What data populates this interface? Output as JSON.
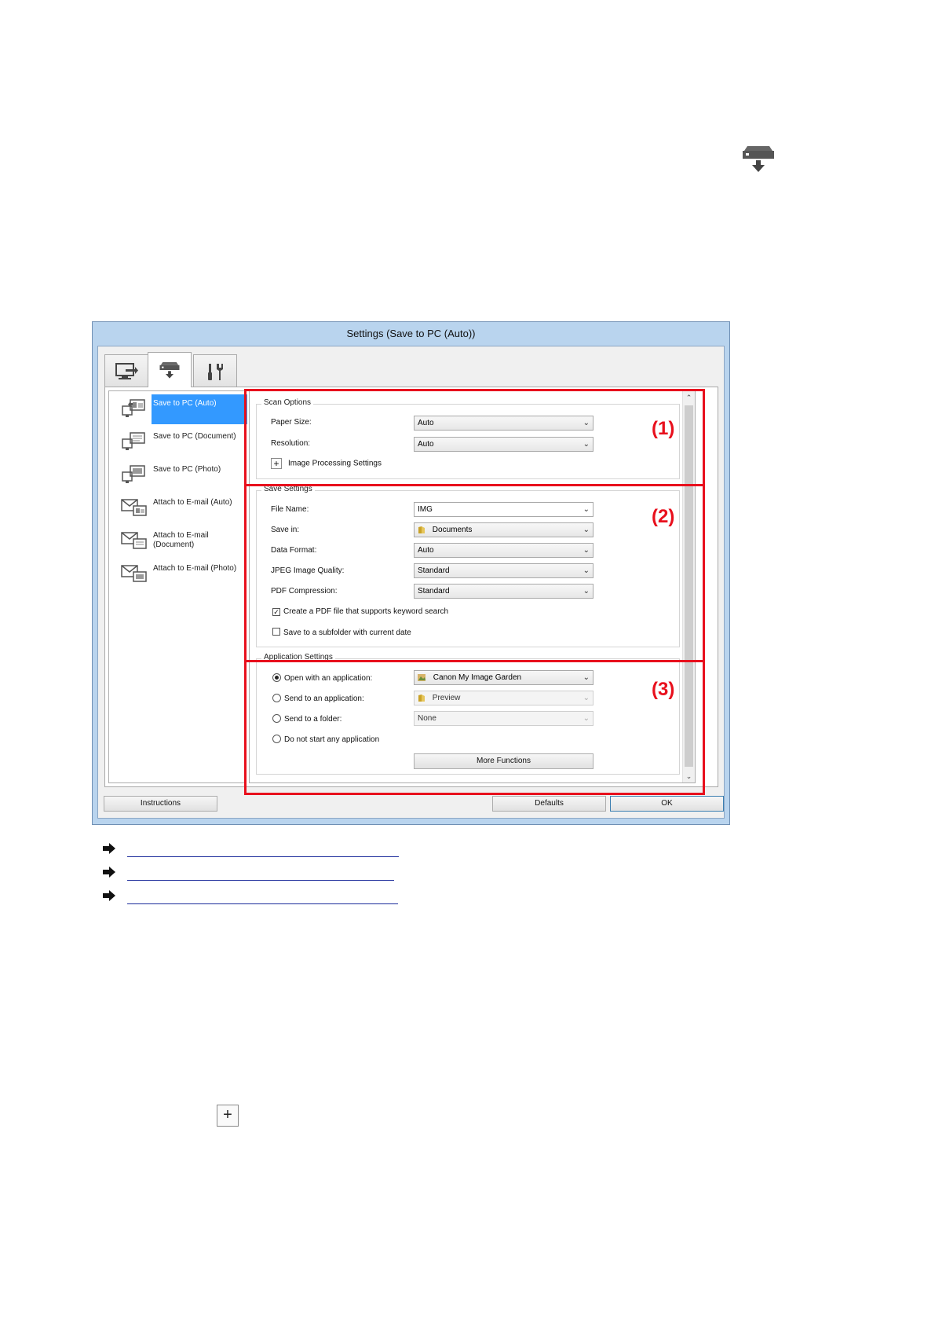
{
  "window": {
    "title": "Settings (Save to PC (Auto))"
  },
  "tabs": [
    {
      "icon": "scan-from-computer-icon",
      "active": false
    },
    {
      "icon": "scan-from-operation-panel-icon",
      "active": true
    },
    {
      "icon": "general-settings-icon",
      "active": false
    }
  ],
  "left_list": {
    "items": [
      {
        "label": "Save to PC (Auto)",
        "icon": "save-to-pc-auto-icon",
        "selected": true
      },
      {
        "label": "Save to PC (Document)",
        "icon": "save-to-pc-document-icon",
        "selected": false
      },
      {
        "label": "Save to PC (Photo)",
        "icon": "save-to-pc-photo-icon",
        "selected": false
      },
      {
        "label": "Attach to E-mail (Auto)",
        "icon": "attach-email-auto-icon",
        "selected": false
      },
      {
        "label": "Attach to E-mail (Document)",
        "icon": "attach-email-document-icon",
        "selected": false
      },
      {
        "label": "Attach to E-mail (Photo)",
        "icon": "attach-email-photo-icon",
        "selected": false
      }
    ]
  },
  "scan_options": {
    "title": "Scan Options",
    "paper_size_label": "Paper Size:",
    "paper_size_value": "Auto",
    "resolution_label": "Resolution:",
    "resolution_value": "Auto",
    "image_processing_label": "Image Processing Settings"
  },
  "save_settings": {
    "title": "Save Settings",
    "file_name_label": "File Name:",
    "file_name_value": "IMG",
    "save_in_label": "Save in:",
    "save_in_value": "Documents",
    "data_format_label": "Data Format:",
    "data_format_value": "Auto",
    "jpeg_quality_label": "JPEG Image Quality:",
    "jpeg_quality_value": "Standard",
    "pdf_compression_label": "PDF Compression:",
    "pdf_compression_value": "Standard",
    "keyword_search_label": "Create a PDF file that supports keyword search",
    "keyword_search_checked": true,
    "subfolder_label": "Save to a subfolder with current date",
    "subfolder_checked": false
  },
  "application_settings": {
    "title": "Application Settings",
    "open_app_label": "Open with an application:",
    "open_app_value": "Canon My Image Garden",
    "send_app_label": "Send to an application:",
    "send_app_value": "Preview",
    "send_folder_label": "Send to a folder:",
    "send_folder_value": "None",
    "do_not_start_label": "Do not start any application",
    "selected_option": "open_app",
    "more_functions_label": "More Functions"
  },
  "buttons": {
    "instructions": "Instructions",
    "defaults": "Defaults",
    "ok": "OK"
  },
  "callouts": [
    "(1)",
    "(2)",
    "(3)"
  ],
  "colors": {
    "callout_red": "#e8101d",
    "selection_blue": "#3399ff",
    "window_frame": "#b9d4ee",
    "link_blue": "#1a2a9a"
  }
}
